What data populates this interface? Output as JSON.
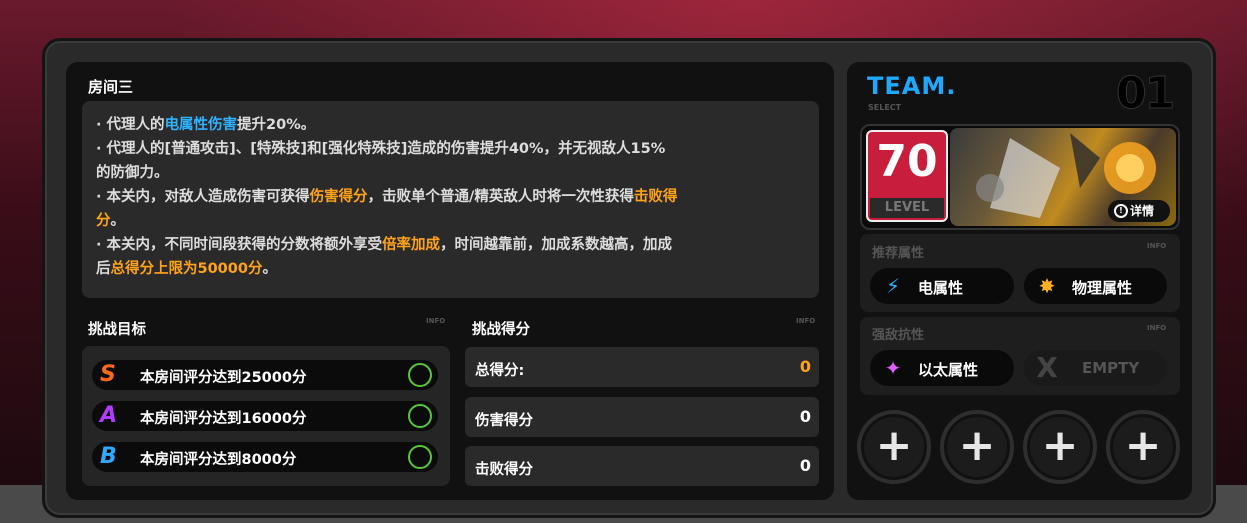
{
  "room": {
    "title": "房间三",
    "desc": {
      "l1a": "· 代理人的",
      "l1b": "电属性伤害",
      "l1c": "提升20%。",
      "l2": "· 代理人的[普通攻击]、[特殊技]和[强化特殊技]造成的伤害提升40%，并无视敌人15%",
      "l3": "的防御力。",
      "l4a": "· 本关内，对敌人造成伤害可获得",
      "l4b": "伤害得分",
      "l4c": "，击败单个普通/精英敌人时将一次性获得",
      "l4d": "击败得",
      "l5a": "分",
      "l5b": "。",
      "l6a": "· 本关内，不同时间段获得的分数将额外享受",
      "l6b": "倍率加成",
      "l6c": "，时间越靠前，加成系数越高，加成",
      "l7a": "后",
      "l7b": "总得分上限为50000分",
      "l7c": "。"
    }
  },
  "goals": {
    "title": "挑战目标",
    "info": "INFO",
    "items": [
      {
        "grade": "S",
        "color": "#ff6a1a",
        "text": "本房间评分达到25000分"
      },
      {
        "grade": "A",
        "color": "#b13cff",
        "text": "本房间评分达到16000分"
      },
      {
        "grade": "B",
        "color": "#2fa8ff",
        "text": "本房间评分达到8000分"
      }
    ]
  },
  "scores": {
    "title": "挑战得分",
    "info": "INFO",
    "items": [
      {
        "label": "总得分:",
        "value": "0",
        "color": "#ffa31a"
      },
      {
        "label": "伤害得分",
        "value": "0",
        "color": "#ffffff"
      },
      {
        "label": "击败得分",
        "value": "0",
        "color": "#ffffff"
      }
    ]
  },
  "team": {
    "title": "TEAM.",
    "select": "SELECT",
    "number": "01",
    "level": "70",
    "level_label": "LEVEL",
    "detail_label": "详情",
    "recommend_title": "推荐属性",
    "recommend_info": "INFO",
    "recommend": [
      {
        "icon": "lightning-icon",
        "label": "电属性"
      },
      {
        "icon": "physical-icon",
        "label": "物理属性"
      }
    ],
    "resist_title": "强敌抗性",
    "resist_info": "INFO",
    "resist": [
      {
        "icon": "ether-icon",
        "label": "以太属性"
      },
      {
        "icon": "empty-x-icon",
        "label": "EMPTY"
      }
    ]
  }
}
